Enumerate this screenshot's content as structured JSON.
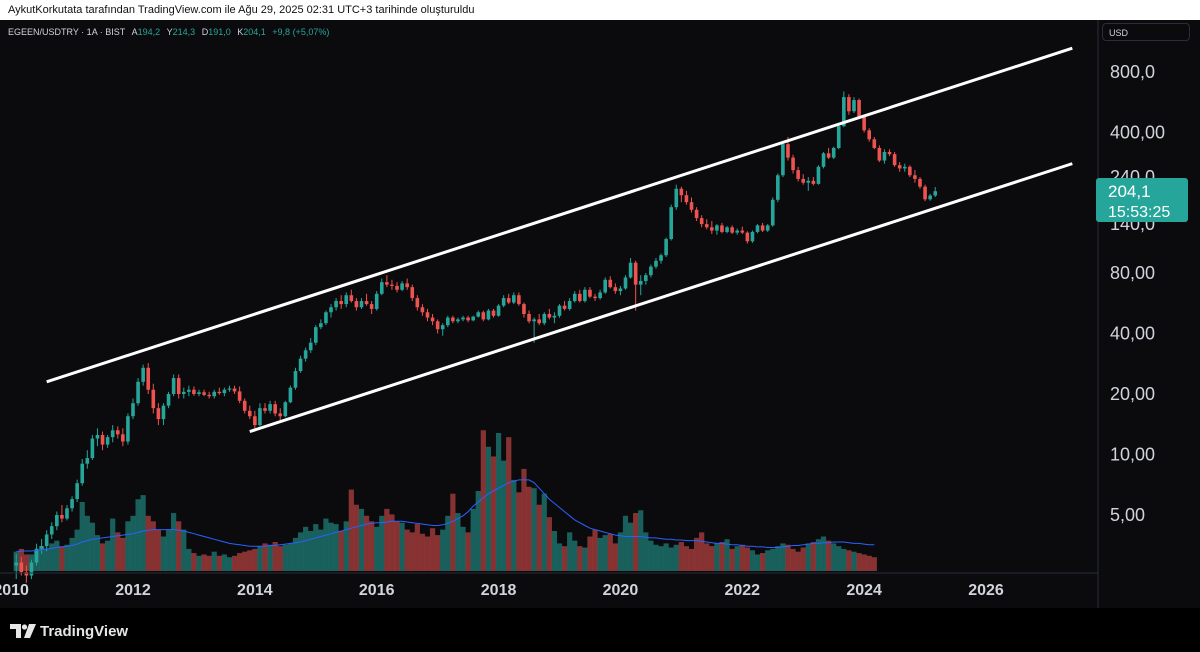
{
  "attribution": "AykutKorkutata tarafından TradingView.com ile Ağu 29, 2025 02:31 UTC+3 tarihinde oluşturuldu",
  "legend": {
    "symbol": "EGEEN/USDTRY · 1A · BIST",
    "open_label": "A",
    "open": "194,2",
    "high_label": "Y",
    "high": "214,3",
    "low_label": "D",
    "low": "191,0",
    "close_label": "K",
    "close": "204,1",
    "change": "+9,8 (+5,07%)"
  },
  "currency_button": "USD",
  "price_tag": {
    "price": "204,1",
    "countdown": "15:53:25"
  },
  "branding": {
    "name": "TradingView"
  },
  "colors": {
    "up": "#26a69a",
    "down": "#ef5350",
    "ma": "#2962ff",
    "channel": "#ffffff",
    "tag_bg": "#26a69a"
  },
  "chart_data": {
    "type": "candlestick",
    "scale": "log",
    "x_tick_labels": [
      "2010",
      "2012",
      "2014",
      "2016",
      "2018",
      "2020",
      "2022",
      "2024",
      "2026"
    ],
    "y_tick_labels": [
      "5,00",
      "10,00",
      "20,00",
      "40,00",
      "80,00",
      "140,0",
      "240,0",
      "400,00",
      "800,0"
    ],
    "last": {
      "open": 194.2,
      "high": 214.3,
      "low": 191.0,
      "close": 204.1
    },
    "channel_lines": [
      {
        "name": "upper",
        "from": [
          "2010-08",
          23
        ],
        "to": [
          "2027-06",
          1050
        ]
      },
      {
        "name": "lower",
        "from": [
          "2013-12",
          13
        ],
        "to": [
          "2027-06",
          280
        ]
      }
    ],
    "candles": [
      [
        2.8,
        3.2,
        2.4,
        2.9
      ],
      [
        2.9,
        3.1,
        2.5,
        2.6
      ],
      [
        2.6,
        2.8,
        2.3,
        2.5
      ],
      [
        2.5,
        3.0,
        2.4,
        2.9
      ],
      [
        2.9,
        3.6,
        2.8,
        3.4
      ],
      [
        3.4,
        3.8,
        3.2,
        3.5
      ],
      [
        3.5,
        4.2,
        3.3,
        4.0
      ],
      [
        4.0,
        4.6,
        3.8,
        4.4
      ],
      [
        4.4,
        5.2,
        4.2,
        5.0
      ],
      [
        5.0,
        5.6,
        4.6,
        4.8
      ],
      [
        4.8,
        5.6,
        4.7,
        5.4
      ],
      [
        5.4,
        6.2,
        5.2,
        6.0
      ],
      [
        6.0,
        7.5,
        5.8,
        7.2
      ],
      [
        7.2,
        9.5,
        7.0,
        9.0
      ],
      [
        9.0,
        10.5,
        8.5,
        9.6
      ],
      [
        9.6,
        12.5,
        9.4,
        12.0
      ],
      [
        12.0,
        13.5,
        11.0,
        12.5
      ],
      [
        12.5,
        13.0,
        10.5,
        11.2
      ],
      [
        11.2,
        12.5,
        10.8,
        12.2
      ],
      [
        12.2,
        14.0,
        11.5,
        13.2
      ],
      [
        13.2,
        13.8,
        12.0,
        12.6
      ],
      [
        12.6,
        13.5,
        11.0,
        11.6
      ],
      [
        11.6,
        16.0,
        11.2,
        15.5
      ],
      [
        15.5,
        19.0,
        15.0,
        18.0
      ],
      [
        18.0,
        24.0,
        17.5,
        23.0
      ],
      [
        23.0,
        28.0,
        22.0,
        27.0
      ],
      [
        27.0,
        28.5,
        20.0,
        21.0
      ],
      [
        21.0,
        22.5,
        16.0,
        17.0
      ],
      [
        17.0,
        18.0,
        14.0,
        15.0
      ],
      [
        15.0,
        18.0,
        14.0,
        17.5
      ],
      [
        17.5,
        20.5,
        17.0,
        20.0
      ],
      [
        20.0,
        25.0,
        19.5,
        24.0
      ],
      [
        24.0,
        25.0,
        19.0,
        20.0
      ],
      [
        20.0,
        21.5,
        19.0,
        20.5
      ],
      [
        20.5,
        22.0,
        19.5,
        21.0
      ],
      [
        21.0,
        21.8,
        19.6,
        20.0
      ],
      [
        20.0,
        21.0,
        19.5,
        20.4
      ],
      [
        20.4,
        21.0,
        19.5,
        19.8
      ],
      [
        19.8,
        20.5,
        19.0,
        19.5
      ],
      [
        19.5,
        21.0,
        19.0,
        20.5
      ],
      [
        20.5,
        21.5,
        19.8,
        20.2
      ],
      [
        20.2,
        21.5,
        19.5,
        21.0
      ],
      [
        21.0,
        22.0,
        20.5,
        21.3
      ],
      [
        21.3,
        22.0,
        20.0,
        20.6
      ],
      [
        20.6,
        21.8,
        18.0,
        18.5
      ],
      [
        18.5,
        19.0,
        16.0,
        16.5
      ],
      [
        16.5,
        17.5,
        15.0,
        15.5
      ],
      [
        15.5,
        16.5,
        13.0,
        14.0
      ],
      [
        14.0,
        18.0,
        13.8,
        17.0
      ],
      [
        17.0,
        18.0,
        16.0,
        16.5
      ],
      [
        16.5,
        18.5,
        16.0,
        17.8
      ],
      [
        17.8,
        18.5,
        15.5,
        16.0
      ],
      [
        16.0,
        17.0,
        14.8,
        15.5
      ],
      [
        15.5,
        18.5,
        15.3,
        18.2
      ],
      [
        18.2,
        22.0,
        18.0,
        21.5
      ],
      [
        21.5,
        27.0,
        21.0,
        26.0
      ],
      [
        26.0,
        31.0,
        25.5,
        30.0
      ],
      [
        30.0,
        34.0,
        29.0,
        33.0
      ],
      [
        33.0,
        38.0,
        32.0,
        36.0
      ],
      [
        36.0,
        44.0,
        35.0,
        43.0
      ],
      [
        43.0,
        47.0,
        42.0,
        45.0
      ],
      [
        45.0,
        52.0,
        44.0,
        51.0
      ],
      [
        51.0,
        56.0,
        48.0,
        54.0
      ],
      [
        54.0,
        60.0,
        52.0,
        58.0
      ],
      [
        58.0,
        62.0,
        53.0,
        56.0
      ],
      [
        56.0,
        64.0,
        54.0,
        62.0
      ],
      [
        62.0,
        66.0,
        57.0,
        58.0
      ],
      [
        58.0,
        60.0,
        52.0,
        54.0
      ],
      [
        54.0,
        60.0,
        53.0,
        58.0
      ],
      [
        58.0,
        63.0,
        55.0,
        56.0
      ],
      [
        56.0,
        58.0,
        50.0,
        53.0
      ],
      [
        53.0,
        65.0,
        52.0,
        63.0
      ],
      [
        63.0,
        75.0,
        62.0,
        72.0
      ],
      [
        72.0,
        78.0,
        68.0,
        70.0
      ],
      [
        70.0,
        74.0,
        66.0,
        69.0
      ],
      [
        69.0,
        72.0,
        64.0,
        66.0
      ],
      [
        66.0,
        73.0,
        65.0,
        71.0
      ],
      [
        71.0,
        75.0,
        66.0,
        68.0
      ],
      [
        68.0,
        70.0,
        58.0,
        60.0
      ],
      [
        60.0,
        62.0,
        52.0,
        54.0
      ],
      [
        54.0,
        56.0,
        49.0,
        51.0
      ],
      [
        51.0,
        53.0,
        46.0,
        48.0
      ],
      [
        48.0,
        50.0,
        44.0,
        46.0
      ],
      [
        46.0,
        47.0,
        40.0,
        42.0
      ],
      [
        42.0,
        45.0,
        39.0,
        44.0
      ],
      [
        44.0,
        49.0,
        43.0,
        48.0
      ],
      [
        48.0,
        49.0,
        45.0,
        46.0
      ],
      [
        46.0,
        48.0,
        45.0,
        47.0
      ],
      [
        47.0,
        49.0,
        46.0,
        48.0
      ],
      [
        48.0,
        49.0,
        45.5,
        46.5
      ],
      [
        46.5,
        49.0,
        46.0,
        48.5
      ],
      [
        48.5,
        52.0,
        48.0,
        51.0
      ],
      [
        51.0,
        52.0,
        46.0,
        47.0
      ],
      [
        47.0,
        53.0,
        46.5,
        52.0
      ],
      [
        52.0,
        53.0,
        48.0,
        49.0
      ],
      [
        49.0,
        56.0,
        48.5,
        55.0
      ],
      [
        55.0,
        62.0,
        54.0,
        60.0
      ],
      [
        60.0,
        63.0,
        56.0,
        57.0
      ],
      [
        57.0,
        64.0,
        56.0,
        62.0
      ],
      [
        62.0,
        64.0,
        55.0,
        56.0
      ],
      [
        56.0,
        57.0,
        48.0,
        50.0
      ],
      [
        50.0,
        52.0,
        45.0,
        46.0
      ],
      [
        46.0,
        48.0,
        36.0,
        47.0
      ],
      [
        47.0,
        50.0,
        44.0,
        45.0
      ],
      [
        45.0,
        51.0,
        44.0,
        50.0
      ],
      [
        50.0,
        53.0,
        47.0,
        48.0
      ],
      [
        48.0,
        51.0,
        45.0,
        49.0
      ],
      [
        49.0,
        56.0,
        48.0,
        55.0
      ],
      [
        55.0,
        58.0,
        52.0,
        53.0
      ],
      [
        53.0,
        60.0,
        52.0,
        58.0
      ],
      [
        58.0,
        65.0,
        57.0,
        63.0
      ],
      [
        63.0,
        66.0,
        57.0,
        58.0
      ],
      [
        58.0,
        68.0,
        57.0,
        66.0
      ],
      [
        66.0,
        68.0,
        60.0,
        61.0
      ],
      [
        61.0,
        63.0,
        58.0,
        60.0
      ],
      [
        60.0,
        66.0,
        59.0,
        64.0
      ],
      [
        64.0,
        76.0,
        63.0,
        74.0
      ],
      [
        74.0,
        77.0,
        67.0,
        68.0
      ],
      [
        68.0,
        71.0,
        63.0,
        65.0
      ],
      [
        65.0,
        69.0,
        62.0,
        67.0
      ],
      [
        67.0,
        78.0,
        66.0,
        76.0
      ],
      [
        76.0,
        95.0,
        75.0,
        90.0
      ],
      [
        90.0,
        92.0,
        52.0,
        70.0
      ],
      [
        70.0,
        78.0,
        62.0,
        73.0
      ],
      [
        73.0,
        80.0,
        70.0,
        78.0
      ],
      [
        78.0,
        88.0,
        76.0,
        86.0
      ],
      [
        86.0,
        95.0,
        84.0,
        92.0
      ],
      [
        92.0,
        100.0,
        89.0,
        98.0
      ],
      [
        98.0,
        120.0,
        96.0,
        118.0
      ],
      [
        118.0,
        175.0,
        116.0,
        170.0
      ],
      [
        170.0,
        220.0,
        165.0,
        210.0
      ],
      [
        210.0,
        215.0,
        180.0,
        195.0
      ],
      [
        195.0,
        205.0,
        175.0,
        180.0
      ],
      [
        180.0,
        190.0,
        160.0,
        165.0
      ],
      [
        165.0,
        170.0,
        145.0,
        150.0
      ],
      [
        150.0,
        155.0,
        135.0,
        140.0
      ],
      [
        140.0,
        148.0,
        132.0,
        135.0
      ],
      [
        135.0,
        145.0,
        125.0,
        130.0
      ],
      [
        130.0,
        140.0,
        124.0,
        138.0
      ],
      [
        138.0,
        142.0,
        126.0,
        128.0
      ],
      [
        128.0,
        137.0,
        126.0,
        135.0
      ],
      [
        135.0,
        138.0,
        125.0,
        127.0
      ],
      [
        127.0,
        133.0,
        124.0,
        130.0
      ],
      [
        130.0,
        136.0,
        125.0,
        127.0
      ],
      [
        127.0,
        129.0,
        112.0,
        115.0
      ],
      [
        115.0,
        130.0,
        113.0,
        128.0
      ],
      [
        128.0,
        140.0,
        126.0,
        138.0
      ],
      [
        138.0,
        142.0,
        128.0,
        130.0
      ],
      [
        130.0,
        140.0,
        128.0,
        138.0
      ],
      [
        138.0,
        190.0,
        136.0,
        185.0
      ],
      [
        185.0,
        250.0,
        180.0,
        245.0
      ],
      [
        245.0,
        360.0,
        240.0,
        350.0
      ],
      [
        350.0,
        380.0,
        290.0,
        300.0
      ],
      [
        300.0,
        310.0,
        250.0,
        260.0
      ],
      [
        260.0,
        270.0,
        228.0,
        235.0
      ],
      [
        235.0,
        248.0,
        220.0,
        225.0
      ],
      [
        225.0,
        240.0,
        205.0,
        230.0
      ],
      [
        230.0,
        240.0,
        218.0,
        222.0
      ],
      [
        222.0,
        275.0,
        220.0,
        270.0
      ],
      [
        270.0,
        320.0,
        265.0,
        315.0
      ],
      [
        315.0,
        335.0,
        295.0,
        300.0
      ],
      [
        300.0,
        340.0,
        295.0,
        335.0
      ],
      [
        335.0,
        440.0,
        330.0,
        430.0
      ],
      [
        430.0,
        640.0,
        425.0,
        600.0
      ],
      [
        600.0,
        620.0,
        490.0,
        510.0
      ],
      [
        510.0,
        600.0,
        500.0,
        580.0
      ],
      [
        580.0,
        590.0,
        470.0,
        480.0
      ],
      [
        480.0,
        490.0,
        400.0,
        410.0
      ],
      [
        410.0,
        420.0,
        360.0,
        370.0
      ],
      [
        370.0,
        380.0,
        330.0,
        335.0
      ],
      [
        335.0,
        345.0,
        285.0,
        290.0
      ],
      [
        290.0,
        330.0,
        280.0,
        320.0
      ],
      [
        320.0,
        330.0,
        305.0,
        312.0
      ],
      [
        312.0,
        320.0,
        270.0,
        275.0
      ],
      [
        275.0,
        285.0,
        255.0,
        265.0
      ],
      [
        265.0,
        280.0,
        255.0,
        270.0
      ],
      [
        270.0,
        275.0,
        240.0,
        245.0
      ],
      [
        245.0,
        260.0,
        225.0,
        235.0
      ],
      [
        235.0,
        240.0,
        210.0,
        215.0
      ],
      [
        215.0,
        220.0,
        182.0,
        186.0
      ],
      [
        186.0,
        198.0,
        183.0,
        194.2
      ],
      [
        194.2,
        214.3,
        191.0,
        204.1
      ]
    ],
    "volume": [
      1.4,
      1.6,
      1.2,
      1.2,
      1.5,
      1.8,
      1.6,
      2.0,
      2.2,
      1.8,
      1.9,
      2.4,
      3.0,
      5.0,
      4.0,
      3.5,
      2.6,
      2.0,
      2.2,
      3.8,
      2.8,
      2.4,
      3.6,
      4.0,
      5.2,
      5.5,
      4.0,
      3.6,
      3.0,
      2.5,
      3.0,
      4.2,
      3.6,
      3.0,
      1.6,
      1.3,
      1.1,
      1.2,
      1.1,
      1.4,
      1.1,
      1.2,
      1.0,
      1.1,
      1.3,
      1.4,
      1.5,
      1.6,
      1.8,
      2.0,
      1.9,
      2.1,
      1.8,
      1.9,
      2.0,
      2.4,
      2.8,
      3.2,
      2.9,
      3.4,
      3.0,
      3.8,
      3.5,
      3.4,
      2.9,
      3.6,
      5.9,
      4.8,
      4.5,
      4.0,
      3.6,
      3.2,
      4.0,
      4.5,
      4.1,
      3.6,
      3.5,
      3.0,
      2.8,
      3.4,
      2.7,
      2.5,
      3.1,
      2.6,
      3.0,
      4.0,
      5.6,
      4.2,
      3.2,
      2.8,
      4.5,
      5.8,
      10.2,
      9.0,
      8.3,
      10.0,
      8.0,
      9.7,
      6.6,
      5.7,
      7.4,
      6.1,
      6.0,
      4.8,
      5.6,
      3.9,
      2.9,
      2.0,
      1.8,
      2.8,
      2.2,
      1.8,
      1.7,
      2.5,
      3.0,
      2.4,
      2.6,
      2.7,
      2.0,
      2.8,
      4.0,
      3.5,
      4.2,
      4.4,
      2.8,
      2.2,
      1.9,
      1.8,
      2.0,
      1.7,
      1.9,
      2.1,
      1.8,
      1.6,
      2.4,
      2.8,
      2.0,
      1.8,
      2.0,
      2.1,
      2.3,
      1.6,
      1.8,
      1.9,
      1.7,
      1.5,
      1.2,
      1.3,
      1.5,
      1.6,
      1.8,
      2.0,
      1.9,
      1.6,
      1.4,
      1.7,
      2.0,
      2.1,
      2.3,
      2.5,
      2.2,
      2.0,
      1.8,
      1.6,
      1.5,
      1.4,
      1.3,
      1.2,
      1.1,
      1.0
    ],
    "volume_ma": [
      1.4,
      1.45,
      1.45,
      1.45,
      1.5,
      1.55,
      1.6,
      1.65,
      1.7,
      1.75,
      1.8,
      1.85,
      1.95,
      2.1,
      2.2,
      2.3,
      2.35,
      2.4,
      2.45,
      2.5,
      2.55,
      2.6,
      2.65,
      2.7,
      2.8,
      2.9,
      2.95,
      3.0,
      3.0,
      3.0,
      3.0,
      3.0,
      2.95,
      2.9,
      2.8,
      2.7,
      2.6,
      2.5,
      2.4,
      2.3,
      2.2,
      2.1,
      2.0,
      1.95,
      1.9,
      1.85,
      1.8,
      1.8,
      1.8,
      1.8,
      1.85,
      1.85,
      1.9,
      1.95,
      2.0,
      2.05,
      2.1,
      2.2,
      2.3,
      2.4,
      2.5,
      2.6,
      2.7,
      2.8,
      2.9,
      3.0,
      3.1,
      3.2,
      3.3,
      3.4,
      3.45,
      3.5,
      3.5,
      3.55,
      3.6,
      3.6,
      3.6,
      3.55,
      3.5,
      3.45,
      3.4,
      3.35,
      3.3,
      3.3,
      3.35,
      3.45,
      3.6,
      3.8,
      4.0,
      4.3,
      4.7,
      5.0,
      5.3,
      5.6,
      5.8,
      6.0,
      6.2,
      6.4,
      6.5,
      6.6,
      6.6,
      6.6,
      6.4,
      6.0,
      5.6,
      5.2,
      4.9,
      4.6,
      4.3,
      4.0,
      3.7,
      3.5,
      3.3,
      3.1,
      3.0,
      2.9,
      2.8,
      2.7,
      2.6,
      2.55,
      2.5,
      2.5,
      2.5,
      2.5,
      2.45,
      2.4,
      2.4,
      2.35,
      2.3,
      2.3,
      2.25,
      2.25,
      2.2,
      2.2,
      2.2,
      2.15,
      2.1,
      2.05,
      2.0,
      2.0,
      1.95,
      1.9,
      1.9,
      1.85,
      1.8,
      1.8,
      1.75,
      1.75,
      1.7,
      1.7,
      1.7,
      1.75,
      1.8,
      1.85,
      1.85,
      1.9,
      1.95,
      2.0,
      2.0,
      2.05,
      2.05,
      2.1,
      2.1,
      2.1,
      2.05,
      2.0,
      2.0,
      1.95,
      1.9,
      1.9
    ]
  }
}
